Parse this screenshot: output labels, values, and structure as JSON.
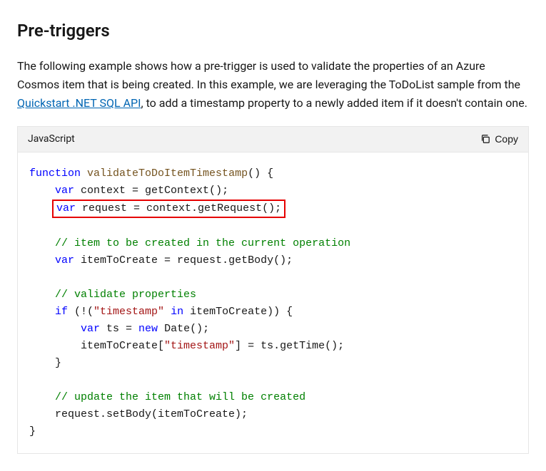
{
  "heading": "Pre-triggers",
  "intro": {
    "part1": "The following example shows how a pre-trigger is used to validate the properties of an Azure Cosmos item that is being created. In this example, we are leveraging the ToDoList sample from the ",
    "link_text": "Quickstart .NET SQL API",
    "part2": ", to add a timestamp property to a newly added item if it doesn't contain one."
  },
  "code_header": {
    "language": "JavaScript",
    "copy_label": "Copy"
  },
  "code": {
    "kw_function": "function",
    "fn_name": "validateToDoItemTimestamp",
    "paren_open_brace": "() {",
    "kw_var": "var",
    "l1_rest": " context = getContext();",
    "l2_rest": " request = context.getRequest();",
    "com1": "// item to be created in the current operation",
    "l3_rest": " itemToCreate = request.getBody();",
    "com2": "// validate properties",
    "kw_if": "if",
    "if_open": " (!(",
    "str_timestamp": "\"timestamp\"",
    "kw_in": "in",
    "if_rest": " itemToCreate)) {",
    "l4_mid": " ts = ",
    "kw_new": "new",
    "l4_end": " Date();",
    "l5_a": "itemToCreate[",
    "l5_b": "] = ts.getTime();",
    "brace_close": "}",
    "com3": "// update the item that will be created",
    "l6": "request.setBody(itemToCreate);"
  }
}
